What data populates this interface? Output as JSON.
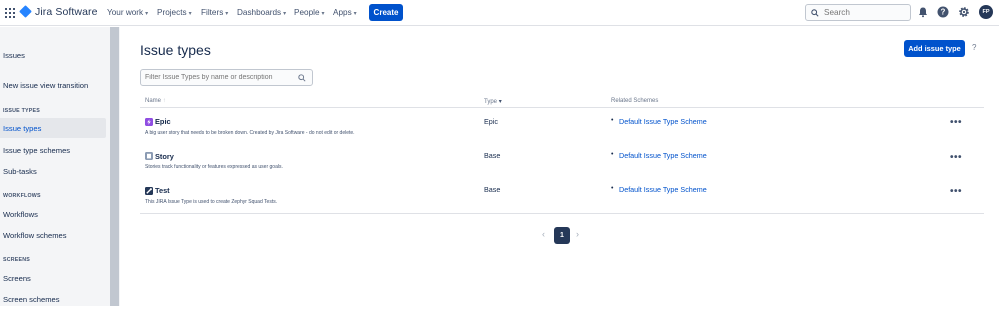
{
  "app": {
    "logo_text": "Jira Software"
  },
  "nav": {
    "items": [
      {
        "label": "Your work"
      },
      {
        "label": "Projects"
      },
      {
        "label": "Filters"
      },
      {
        "label": "Dashboards"
      },
      {
        "label": "People"
      },
      {
        "label": "Apps"
      }
    ],
    "create_label": "Create",
    "search_placeholder": "Search",
    "avatar_initials": "FP"
  },
  "sidebar": {
    "title": "Issues",
    "new_view": "New issue view transition",
    "sections": [
      {
        "heading": "ISSUE TYPES",
        "items": [
          "Issue types",
          "Issue type schemes",
          "Sub-tasks"
        ]
      },
      {
        "heading": "WORKFLOWS",
        "items": [
          "Workflows",
          "Workflow schemes"
        ]
      },
      {
        "heading": "SCREENS",
        "items": [
          "Screens",
          "Screen schemes"
        ]
      }
    ],
    "active_item": "Issue types"
  },
  "main": {
    "title": "Issue types",
    "add_button": "Add issue type",
    "help": "?",
    "filter_placeholder": "Filter Issue Types by name or description",
    "columns": {
      "name": "Name",
      "type": "Type",
      "related": "Related Schemes"
    },
    "rows": [
      {
        "name": "Epic",
        "description": "A big user story that needs to be broken down. Created by Jira Software - do not edit or delete.",
        "type": "Epic",
        "scheme": "Default Issue Type Scheme",
        "icon": "epic-icon",
        "icon_color": "#904ee2"
      },
      {
        "name": "Story",
        "description": "Stories track functionality or features expressed as user goals.",
        "type": "Base",
        "scheme": "Default Issue Type Scheme",
        "icon": "story-icon",
        "icon_color": "#8b9bb3"
      },
      {
        "name": "Test",
        "description": "This JIRA Issue Type is used to create Zephyr Squad Tests.",
        "type": "Base",
        "scheme": "Default Issue Type Scheme",
        "icon": "test-icon",
        "icon_color": "#253858"
      }
    ],
    "more": "•••",
    "pagination": {
      "current": "1",
      "prev": "‹",
      "next": "›"
    }
  }
}
